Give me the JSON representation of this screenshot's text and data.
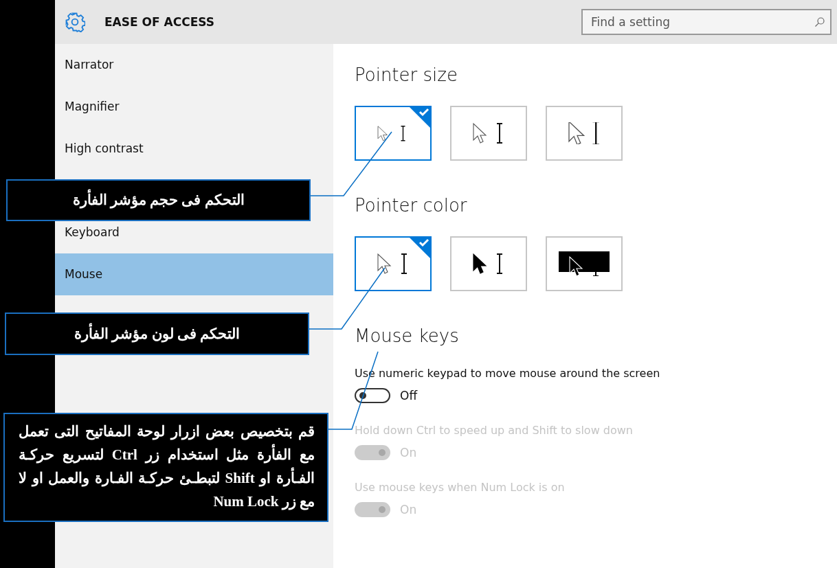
{
  "header": {
    "title": "EASE OF ACCESS",
    "search": {
      "placeholder": "Find a setting"
    }
  },
  "sidebar": {
    "items": [
      {
        "label": "Narrator",
        "selected": false
      },
      {
        "label": "Magnifier",
        "selected": false
      },
      {
        "label": "High contrast",
        "selected": false
      },
      {
        "label": "Keyboard",
        "selected": false,
        "gap_before": true
      },
      {
        "label": "Mouse",
        "selected": true
      }
    ]
  },
  "sections": [
    {
      "title": "Pointer size",
      "tiles": [
        {
          "kind": "small",
          "selected": true
        },
        {
          "kind": "medium",
          "selected": false
        },
        {
          "kind": "large",
          "selected": false
        }
      ]
    },
    {
      "title": "Pointer color",
      "tiles": [
        {
          "kind": "white",
          "selected": true
        },
        {
          "kind": "black",
          "selected": false
        },
        {
          "kind": "inverted",
          "selected": false
        }
      ]
    }
  ],
  "mouse_keys": {
    "title": "Mouse keys",
    "settings": [
      {
        "label": "Use numeric keypad to move mouse around the screen",
        "on": false,
        "disabled": false,
        "state": "Off"
      },
      {
        "label": "Hold down Ctrl to speed up and Shift to slow down",
        "on": true,
        "disabled": true,
        "state": "On"
      },
      {
        "label": "Use mouse keys when Num Lock is on",
        "on": true,
        "disabled": true,
        "state": "On"
      }
    ]
  },
  "callouts": [
    {
      "text": "التحكم فى حجم مؤشر الفأرة"
    },
    {
      "text": "التحكم فى لون مؤشر الفأرة"
    },
    {
      "text": "قم بتخصيص بعض ازرار لوحة المفاتيح التى تعمل مع الفأرة مثل استخدام زر Ctrl لتسريع حركـة الفـأرة او Shift لتبطـئ حركـة الفـارة والعمل او لا مع زر Num Lock"
    }
  ]
}
